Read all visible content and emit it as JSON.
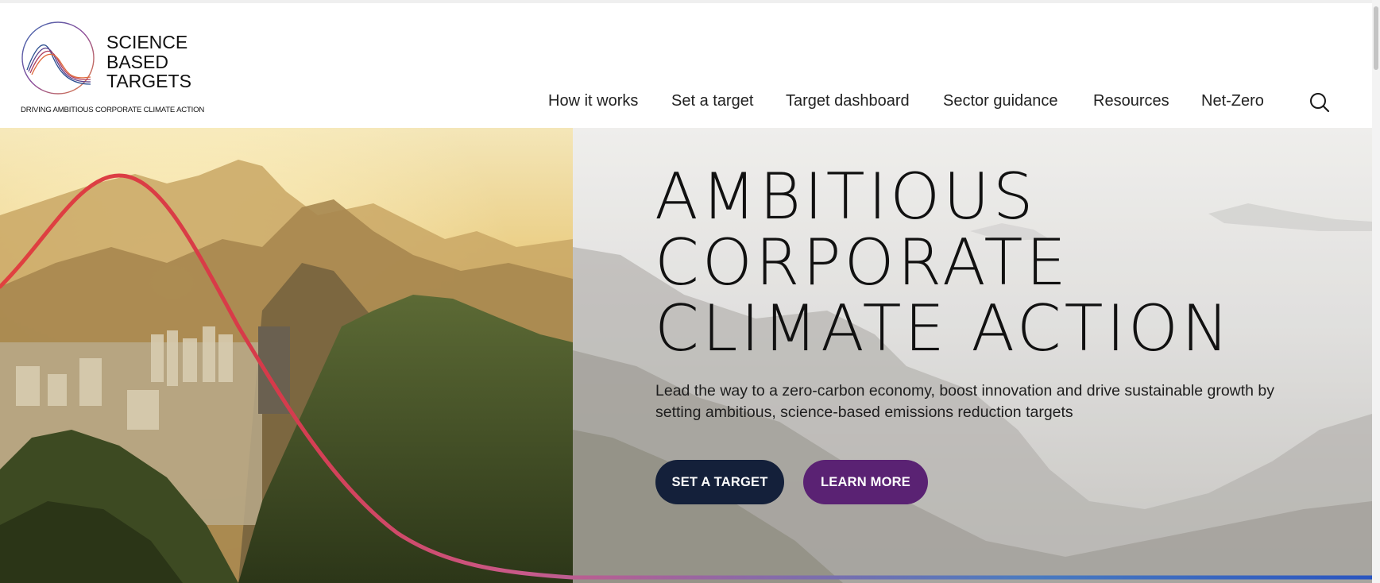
{
  "logo": {
    "line1": "SCIENCE",
    "line2": "BASED",
    "line3": "TARGETS",
    "tagline": "DRIVING AMBITIOUS CORPORATE CLIMATE ACTION"
  },
  "nav": {
    "items": [
      {
        "label": "How it works"
      },
      {
        "label": "Set a target"
      },
      {
        "label": "Target dashboard"
      },
      {
        "label": "Sector guidance"
      },
      {
        "label": "Resources"
      },
      {
        "label": "Net-Zero"
      }
    ],
    "search_icon": "search-icon"
  },
  "hero": {
    "headline": {
      "line1": "AMBITIOUS",
      "line2": "CORPORATE",
      "line3": "CLIMATE ACTION"
    },
    "lede": "Lead the way to a zero-carbon economy, boost innovation and drive sustainable growth by setting ambitious, science-based emissions reduction targets",
    "primary_button": "SET A TARGET",
    "secondary_button": "LEARN MORE"
  },
  "colors": {
    "primary_button": "#14203a",
    "secondary_button": "#5a2273",
    "curve_start": "#e0403f",
    "curve_mid": "#c95a8a",
    "curve_end": "#2a55c0"
  }
}
